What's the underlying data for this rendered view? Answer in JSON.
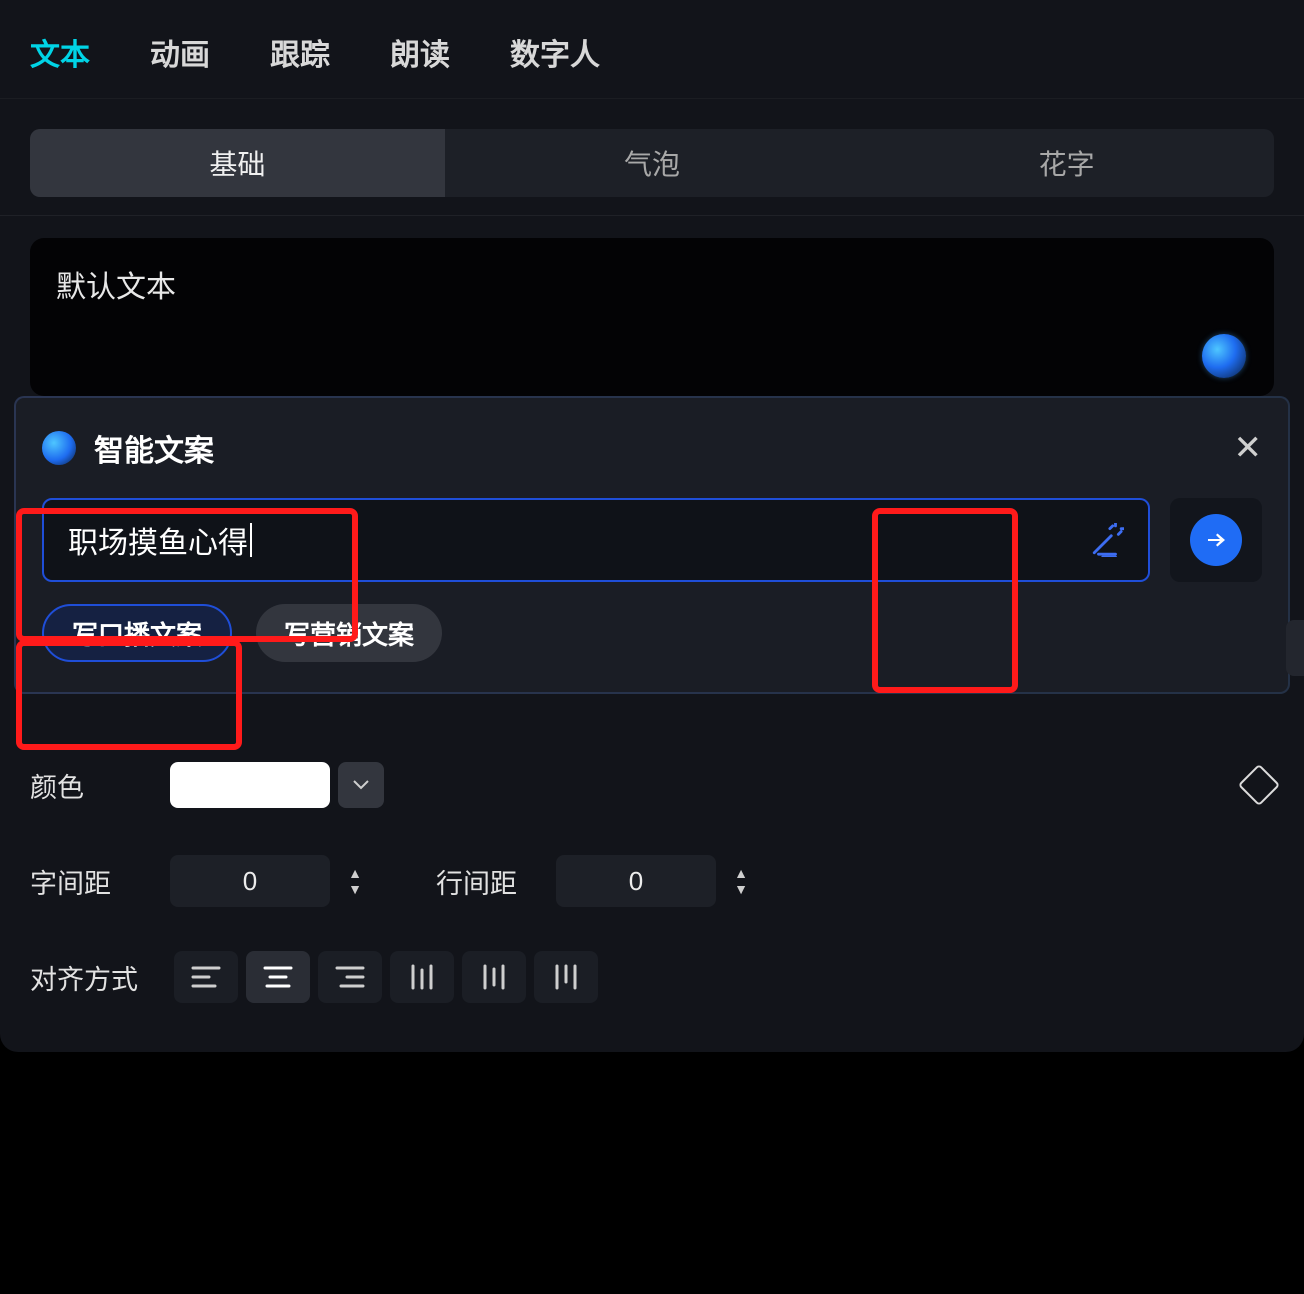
{
  "top_tabs": {
    "text": "文本",
    "animation": "动画",
    "track": "跟踪",
    "read": "朗读",
    "digital": "数字人",
    "active": "text"
  },
  "sub_tabs": {
    "basic": "基础",
    "bubble": "气泡",
    "fancy": "花字",
    "active": "basic"
  },
  "text_area": {
    "value": "默认文本"
  },
  "smart": {
    "title": "智能文案",
    "input_value": "职场摸鱼心得",
    "chip_primary": "写口播文案",
    "chip_secondary": "写营销文案"
  },
  "controls": {
    "color_label": "颜色",
    "color_value": "#FFFFFF",
    "letter_spacing_label": "字间距",
    "letter_spacing_value": "0",
    "line_spacing_label": "行间距",
    "line_spacing_value": "0",
    "align_label": "对齐方式"
  }
}
